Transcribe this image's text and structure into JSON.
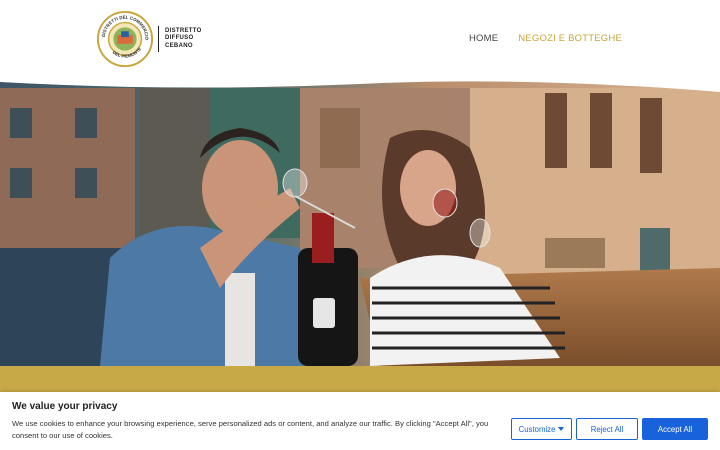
{
  "header": {
    "logo": {
      "seal_text": "DISTRETTI DEL COMMERCIO DEL PIEMONTE",
      "text_lines": [
        "DISTRETTO",
        "DIFFUSO",
        "CEBANO"
      ]
    },
    "nav": [
      {
        "label": "HOME",
        "active": false
      },
      {
        "label": "NEGOZI E BOTTEGHE",
        "active": true
      }
    ]
  },
  "hero": {
    "image": "couple-drinking-red-wine-at-cafe-photo"
  },
  "colors": {
    "accent_gold": "#c7aa47",
    "nav_active": "#c9a53a",
    "cookie_blue": "#1863dc"
  },
  "cookie_banner": {
    "title": "We value your privacy",
    "text": "We use cookies to enhance your browsing experience, serve personalized ads or content, and analyze our traffic. By clicking \"Accept All\", you consent to our use of cookies.",
    "customize_label": "Customize",
    "reject_label": "Reject All",
    "accept_label": "Accept All"
  }
}
